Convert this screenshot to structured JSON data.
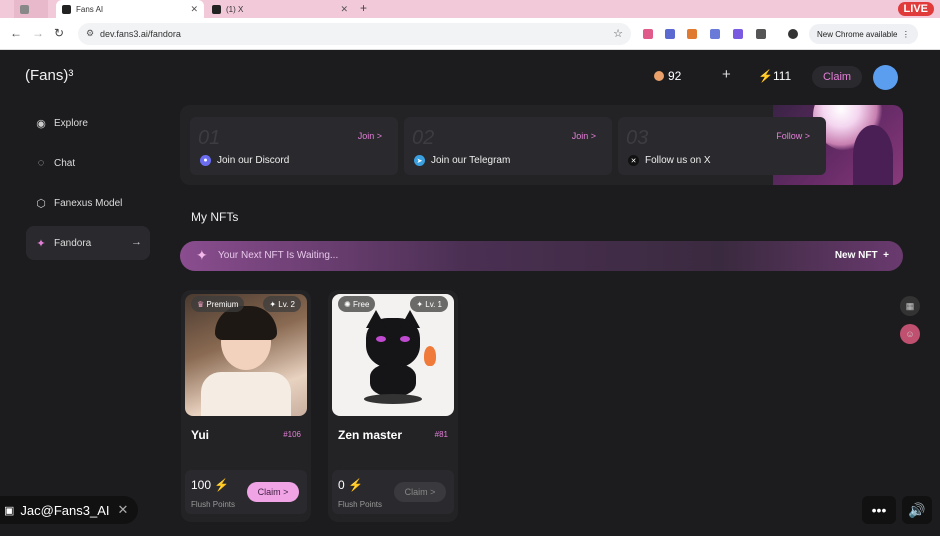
{
  "browser": {
    "tabs": [
      {
        "label": "Fans AI"
      },
      {
        "label": "(1) X"
      }
    ],
    "url": "dev.fans3.ai/fandora",
    "new_chrome": "New Chrome available",
    "live_badge": "LIVE"
  },
  "header": {
    "logo": "(Fans)³",
    "coins": "92",
    "plus": "+",
    "bolts": "111",
    "claim": "Claim"
  },
  "sidebar": {
    "items": [
      {
        "label": "Explore",
        "icon": "eye-icon"
      },
      {
        "label": "Chat",
        "icon": "chat-icon"
      },
      {
        "label": "Fanexus Model",
        "icon": "cube-icon"
      },
      {
        "label": "Fandora",
        "icon": "sparkle-icon",
        "active": true
      }
    ]
  },
  "tasks": [
    {
      "num": "01",
      "cta": "Join >",
      "label": "Join our Discord",
      "color": "#6b6df0"
    },
    {
      "num": "02",
      "cta": "Join >",
      "label": "Join our Telegram",
      "color": "#3aa0e0"
    },
    {
      "num": "03",
      "cta": "Follow >",
      "label": "Follow us on X",
      "color": "#111111"
    }
  ],
  "section": {
    "title": "My NFTs"
  },
  "nft_banner": {
    "text": "Your Next NFT Is Waiting...",
    "cta": "New NFT"
  },
  "nfts": [
    {
      "tier": "Premium",
      "level": "Lv. 2",
      "name": "Yui",
      "id": "#106",
      "points": "100",
      "points_label": "Flush Points",
      "claim": "Claim >"
    },
    {
      "tier": "Free",
      "level": "Lv. 1",
      "name": "Zen master",
      "id": "#81",
      "points": "0",
      "points_label": "Flush Points",
      "claim": "Claim >"
    }
  ],
  "overlay": {
    "handle": "Jac@Fans3_AI",
    "more": "•••"
  },
  "colors": {
    "accent": "#e47fd8",
    "bg": "#1c1c1f"
  }
}
